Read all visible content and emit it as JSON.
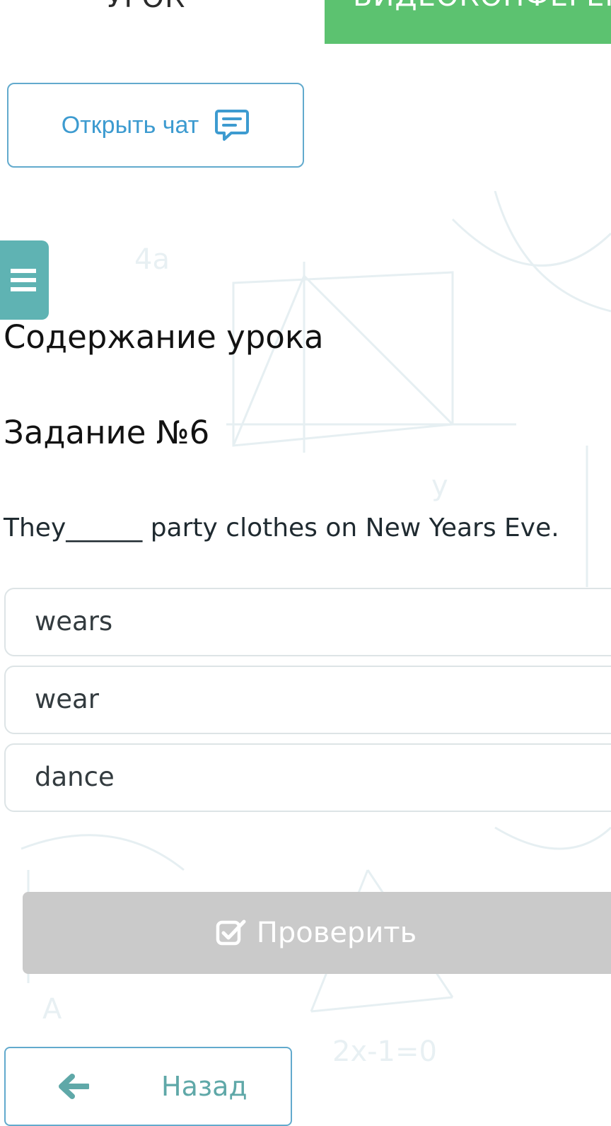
{
  "top_tabs": {
    "lesson": "УРОК",
    "video": "ВИДЕОКОНФЕРЕНЦИЯ"
  },
  "chat": {
    "label": "Открыть чат",
    "icon": "chat-icon"
  },
  "menu": {
    "icon": "hamburger-menu-icon"
  },
  "lesson": {
    "content_title": "Содержание урока",
    "task_title": "Задание №6",
    "question": "They______ party clothes on New Years Eve.",
    "options": [
      "wears",
      "wear",
      "dance"
    ]
  },
  "check": {
    "label": "Проверить",
    "icon": "checkbox-icon"
  },
  "back": {
    "label": "Назад",
    "icon": "arrow-left-icon"
  },
  "colors": {
    "accent_blue": "#3d9bd0",
    "teal": "#5fb3b3",
    "green": "#5cc270",
    "disabled_gray": "#cacaca"
  }
}
